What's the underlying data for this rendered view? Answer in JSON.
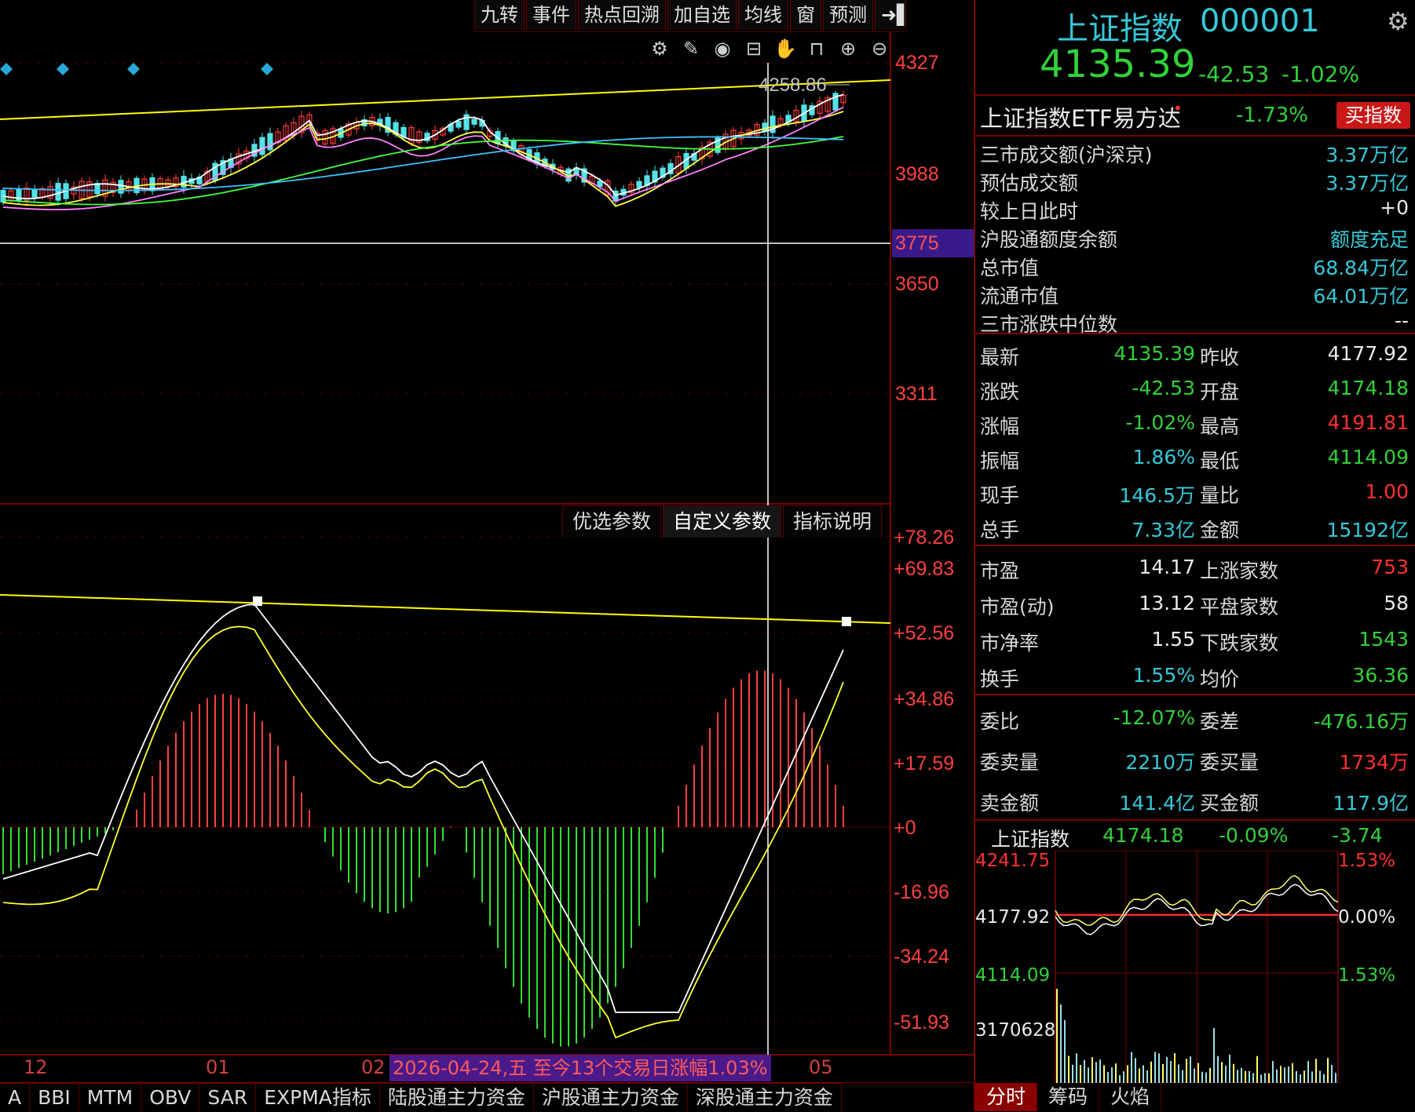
{
  "toolbar": {
    "items": [
      "九转",
      "事件",
      "热点回溯",
      "加自选",
      "均线",
      "窗",
      "预测"
    ],
    "exit_icon": "exit-arrow-icon"
  },
  "icon_row": [
    "gear-icon",
    "pen-icon",
    "eye-icon",
    "toolbox-icon",
    "hand-icon",
    "lock-icon",
    "zoom-in-icon",
    "zoom-out-icon"
  ],
  "price_chart": {
    "high_label": "4258.86",
    "axis_labels": [
      "4327",
      "3988",
      "3775",
      "3650",
      "3311"
    ],
    "highlight_label": "3775",
    "colors": {
      "up": "#ff3b3b",
      "down": "#54e2e8",
      "ma5": "#ffffff",
      "ma10": "#ffff44",
      "ma20": "#ff80ff",
      "ma30": "#40ff40",
      "ma60": "#40c0ff",
      "trend": "#ffff00",
      "marker": "#29a9d8"
    }
  },
  "macd_tabs": [
    "优选参数",
    "自定义参数",
    "指标说明"
  ],
  "macd_active_tab": "自定义参数",
  "macd_axis_labels": [
    "+78.26",
    "+69.83",
    "+52.56",
    "+34.86",
    "+17.59",
    "+0",
    "-16.96",
    "-34.24",
    "-51.93"
  ],
  "x_ticks": [
    "12",
    "01",
    "02",
    "05"
  ],
  "date_note": "2026-04-24,五 至今13个交易日涨幅1.03%",
  "indicator_tabs": [
    "A",
    "BBI",
    "MTM",
    "OBV",
    "SAR",
    "EXPMA指标",
    "陆股通主力资金",
    "沪股通主力资金",
    "深股通主力资金"
  ],
  "header": {
    "name": "上证指数",
    "code": "000001",
    "price": "4135.39",
    "change": "-42.53",
    "change_pct": "-1.02%",
    "settings_icon": "gear-icon"
  },
  "etf": {
    "name": "上证指数ETF易方达",
    "dot": "•",
    "pct": "-1.73%",
    "button": "买指数"
  },
  "market_rows": [
    {
      "label": "三市成交额(沪深京)",
      "value": "3.37万亿"
    },
    {
      "label": "预估成交额",
      "value": "3.37万亿"
    },
    {
      "label": "较上日此时",
      "value": "+0"
    },
    {
      "label": "沪股通额度余额",
      "value": "额度充足"
    },
    {
      "label": "总市值",
      "value": "68.84万亿"
    },
    {
      "label": "流通市值",
      "value": "64.01万亿"
    },
    {
      "label": "三市涨跌中位数",
      "value": "--"
    }
  ],
  "quote_rows": [
    {
      "l1": "最新",
      "v1": "4135.39",
      "l2": "昨收",
      "v2": "4177.92"
    },
    {
      "l1": "涨跌",
      "v1": "-42.53",
      "l2": "开盘",
      "v2": "4174.18"
    },
    {
      "l1": "涨幅",
      "v1": "-1.02%",
      "l2": "最高",
      "v2": "4191.81"
    },
    {
      "l1": "振幅",
      "v1": "1.86%",
      "l2": "最低",
      "v2": "4114.09"
    },
    {
      "l1": "现手",
      "v1": "146.5万",
      "l2": "量比",
      "v2": "1.00"
    },
    {
      "l1": "总手",
      "v1": "7.33亿",
      "l2": "金额",
      "v2": "15192亿"
    }
  ],
  "valuation_rows": [
    {
      "l1": "市盈",
      "v1": "14.17",
      "l2": "上涨家数",
      "v2": "753"
    },
    {
      "l1": "市盈(动)",
      "v1": "13.12",
      "l2": "平盘家数",
      "v2": "58"
    },
    {
      "l1": "市净率",
      "v1": "1.55",
      "l2": "下跌家数",
      "v2": "1543"
    },
    {
      "l1": "换手",
      "v1": "1.55%",
      "l2": "均价",
      "v2": "36.36"
    }
  ],
  "order_rows": [
    {
      "l1": "委比",
      "v1": "-12.07%",
      "l2": "委差",
      "v2": "-476.16万"
    },
    {
      "l1": "委卖量",
      "v1": "2210万",
      "l2": "委买量",
      "v2": "1734万"
    },
    {
      "l1": "卖金额",
      "v1": "141.4亿",
      "l2": "买金额",
      "v2": "117.9亿"
    }
  ],
  "mini_chart": {
    "title": "上证指数",
    "price": "4174.18",
    "pct": "-0.09%",
    "change": "-3.74",
    "left_labels": [
      "4241.75",
      "4177.92",
      "4114.09",
      "3170628"
    ],
    "right_labels": [
      "1.53%",
      "0.00%",
      "1.53%"
    ]
  },
  "right_tabs": [
    "分时",
    "筹码",
    "火焰"
  ],
  "right_active_tab": "分时"
}
